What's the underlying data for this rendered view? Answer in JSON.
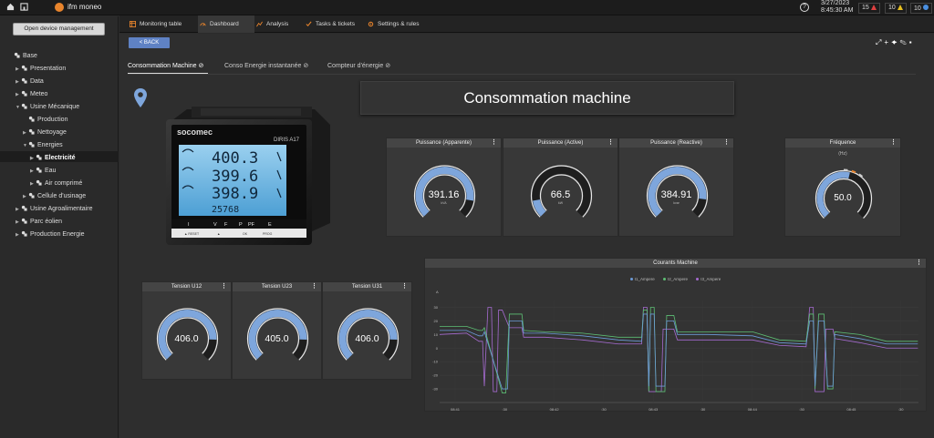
{
  "topbar": {
    "app_name": "ifm moneo",
    "date": "3/27/2023",
    "time": "8:45:30 AM",
    "alarms": [
      {
        "count": "15",
        "color": "#e04040"
      },
      {
        "count": "10",
        "color": "#e8c020"
      },
      {
        "count": "10",
        "color": "#4a8fe0"
      }
    ]
  },
  "sidebar": {
    "open_device_management": "Open device management",
    "tree": [
      {
        "label": "Base",
        "arrow": "",
        "indent": 0
      },
      {
        "label": "Presentation",
        "arrow": "▶",
        "indent": 1
      },
      {
        "label": "Data",
        "arrow": "▶",
        "indent": 1
      },
      {
        "label": "Meteo",
        "arrow": "▶",
        "indent": 1
      },
      {
        "label": "Usine Mécanique",
        "arrow": "▼",
        "indent": 1
      },
      {
        "label": "Production",
        "arrow": "",
        "indent": 2
      },
      {
        "label": "Nettoyage",
        "arrow": "▶",
        "indent": 2
      },
      {
        "label": "Energies",
        "arrow": "▼",
        "indent": 2
      },
      {
        "label": "Electricité",
        "arrow": "▶",
        "indent": 3
      },
      {
        "label": "Eau",
        "arrow": "▶",
        "indent": 3
      },
      {
        "label": "Air comprimé",
        "arrow": "▶",
        "indent": 3
      },
      {
        "label": "Cellule d'usinage",
        "arrow": "▶",
        "indent": 2
      },
      {
        "label": "Usine Agroalimentaire",
        "arrow": "▶",
        "indent": 1
      },
      {
        "label": "Parc éolien",
        "arrow": "▶",
        "indent": 1
      },
      {
        "label": "Production Energie",
        "arrow": "▶",
        "indent": 1
      }
    ]
  },
  "tabs": [
    {
      "label": "Monitoring table",
      "icon": "table-icon"
    },
    {
      "label": "Dashboard",
      "icon": "dashboard-icon"
    },
    {
      "label": "Analysis",
      "icon": "analysis-icon"
    },
    {
      "label": "Tasks & tickets",
      "icon": "tasks-icon"
    },
    {
      "label": "Settings & rules",
      "icon": "settings-icon"
    }
  ],
  "back_label": "BACK",
  "subtabs": [
    "Consommation Machine",
    "Conso Energie instantanée",
    "Compteur d'énergie"
  ],
  "page_title": "Consommation machine",
  "device_display": {
    "brand": "socomec",
    "model": "DIRIS A17",
    "rows": [
      "400.3",
      "399.6",
      "398.9"
    ],
    "counter": "25768",
    "buttons": [
      "I",
      "V",
      "F",
      "P",
      "PF",
      "E"
    ],
    "footer": [
      "▲ RESET",
      "▲",
      "OK",
      "PROG"
    ]
  },
  "gauges_top": [
    {
      "title": "Puissance (Apparente)",
      "value": "391.16",
      "unit": "kVA",
      "fraction": 0.87
    },
    {
      "title": "Puissance (Active)",
      "value": "66.5",
      "unit": "kW",
      "fraction": 0.13
    },
    {
      "title": "Puissance (Reactive)",
      "value": "384.91",
      "unit": "kvar",
      "fraction": 0.86
    }
  ],
  "frequency": {
    "title": "Fréquence",
    "value": "50.0",
    "unit": "(Hz)",
    "fraction": 0.55
  },
  "gauges_bottom": [
    {
      "title": "Tension U12",
      "value": "406.0",
      "fraction": 0.84
    },
    {
      "title": "Tension U23",
      "value": "405.0",
      "fraction": 0.84
    },
    {
      "title": "Tension U31",
      "value": "406.0",
      "fraction": 0.84
    }
  ],
  "chart_data": {
    "type": "line",
    "title": "Courants Machine",
    "ylabel": "A",
    "ylim": [
      -40,
      35
    ],
    "yticks": [
      30,
      20,
      10,
      0,
      -10,
      -20,
      -30
    ],
    "xticks": [
      "08:41",
      ":30",
      "08:42",
      ":30",
      "08:43",
      ":30",
      "08:44",
      ":30",
      "08:45",
      ":30"
    ],
    "legend_position": "top",
    "series": [
      {
        "name": "I1_Ampere",
        "color": "#6c9bd8"
      },
      {
        "name": "I2_Ampere",
        "color": "#5dbf74"
      },
      {
        "name": "I3_Ampere",
        "color": "#a66bd1"
      }
    ]
  }
}
